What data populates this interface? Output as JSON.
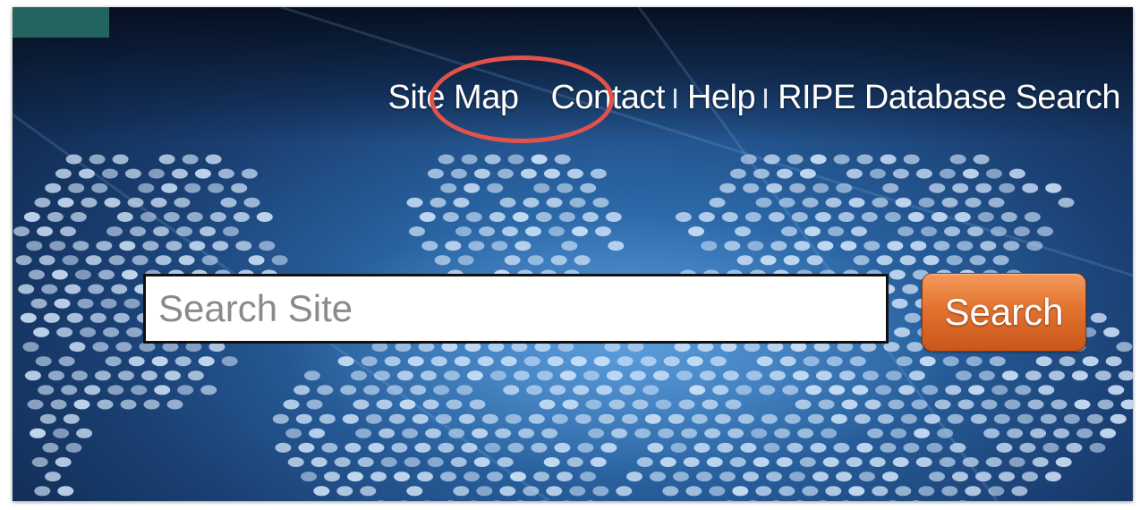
{
  "header": {
    "nav": [
      {
        "label": "Site Map"
      },
      {
        "label": "Contact"
      },
      {
        "label": "Help"
      },
      {
        "label": "RIPE Database Search"
      }
    ]
  },
  "search": {
    "placeholder": "Search Site",
    "value": "",
    "button_label": "Search"
  },
  "colors": {
    "background_blue": "#2a64a3",
    "corner_block": "#24645f",
    "highlight_circle": "#e2524a",
    "button_orange": "#e2732f"
  },
  "icons": {
    "nav_separator": "vertical-bar"
  }
}
